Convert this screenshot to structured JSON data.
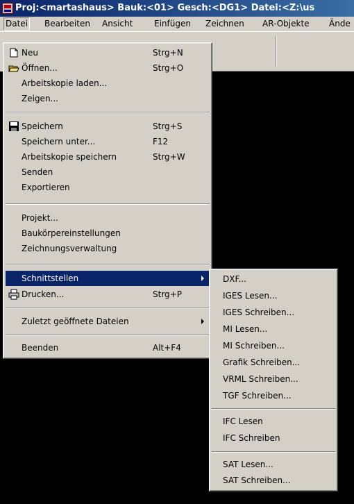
{
  "window": {
    "title": "Proj:<martashaus> Bauk:<01> Gesch:<DG1> Datei:<Z:\\us"
  },
  "menubar": [
    "Datei",
    "Bearbeiten",
    "Ansicht",
    "Einfügen",
    "Zeichnen",
    "AR-Objekte",
    "Ände"
  ],
  "file_menu": [
    {
      "label": "Neu",
      "shortcut": "Strg+N",
      "icon": "new-document-icon"
    },
    {
      "label": "Öffnen...",
      "shortcut": "Strg+O",
      "icon": "open-folder-icon"
    },
    {
      "label": "Arbeitskopie laden...",
      "shortcut": ""
    },
    {
      "label": "Zeigen...",
      "shortcut": ""
    },
    {
      "label": "Speichern",
      "shortcut": "Strg+S",
      "icon": "floppy-disk-icon"
    },
    {
      "label": "Speichern unter...",
      "shortcut": "F12"
    },
    {
      "label": "Arbeitskopie speichern",
      "shortcut": "Strg+W"
    },
    {
      "label": "Senden",
      "shortcut": ""
    },
    {
      "label": "Exportieren",
      "shortcut": ""
    },
    {
      "label": "Projekt...",
      "shortcut": ""
    },
    {
      "label": "Baukörpereinstellungen",
      "shortcut": ""
    },
    {
      "label": "Zeichnungsverwaltung",
      "shortcut": ""
    },
    {
      "label": "Schnittstellen",
      "shortcut": "",
      "submenu": true,
      "highlighted": true
    },
    {
      "label": "Drucken...",
      "shortcut": "Strg+P",
      "icon": "printer-icon"
    },
    {
      "label": "Zuletzt geöffnete Dateien",
      "shortcut": "",
      "submenu": true
    },
    {
      "label": "Beenden",
      "shortcut": "Alt+F4"
    }
  ],
  "schnittstellen_submenu": [
    "DXF...",
    "IGES Lesen...",
    "IGES Schreiben...",
    "MI Lesen...",
    "MI Schreiben...",
    "Grafik Schreiben...",
    "VRML Schreiben...",
    "TGF Schreiben...",
    "IFC Lesen",
    "IFC Schreiben",
    "SAT Lesen...",
    "SAT Schreiben..."
  ],
  "colors": {
    "highlight": "#0a246a",
    "menu_bg": "#d4d0c8",
    "canvas": "#000000"
  }
}
